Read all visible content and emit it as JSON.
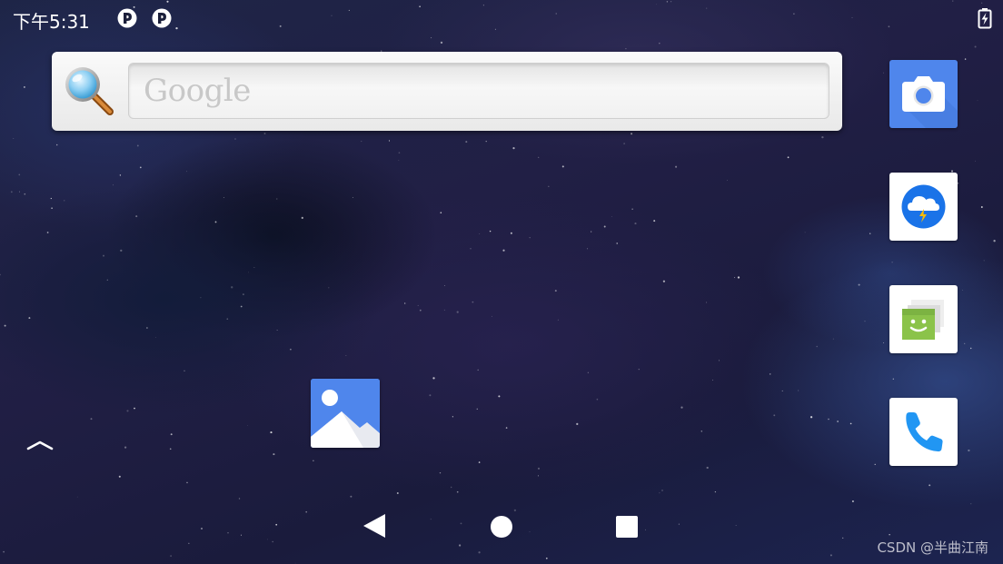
{
  "status_bar": {
    "time": "下午5:31",
    "notification_icons": [
      "pocket-p-icon",
      "pocket-p-icon"
    ],
    "battery_icon": "battery-charging-icon"
  },
  "search_widget": {
    "placeholder": "Google",
    "icon": "magnifier-icon"
  },
  "apps": {
    "dock_right": [
      {
        "name": "camera",
        "icon": "camera-icon",
        "color": "#4f86ec"
      },
      {
        "name": "weather",
        "icon": "weather-icon",
        "color": "#1a73e8"
      },
      {
        "name": "messaging",
        "icon": "messaging-icon",
        "color": "#8bc34a"
      },
      {
        "name": "phone",
        "icon": "phone-icon",
        "color": "#2196f3"
      }
    ],
    "home": [
      {
        "name": "gallery",
        "icon": "gallery-icon",
        "color": "#4f86ec"
      }
    ]
  },
  "drawer": {
    "icon": "chevron-up-icon"
  },
  "nav_bar": {
    "back_icon": "back-triangle-icon",
    "home_icon": "home-circle-icon",
    "recents_icon": "recents-square-icon"
  },
  "watermark": "CSDN @半曲江南"
}
